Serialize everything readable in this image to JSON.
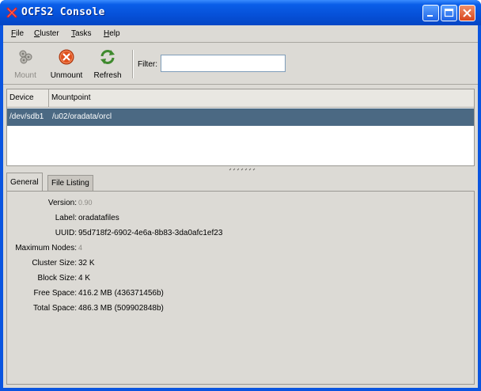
{
  "window": {
    "title": "OCFS2 Console"
  },
  "menu": {
    "file": {
      "mnemonic": "F",
      "rest": "ile"
    },
    "cluster": {
      "mnemonic": "C",
      "rest": "luster"
    },
    "tasks": {
      "mnemonic": "T",
      "rest": "asks"
    },
    "help": {
      "mnemonic": "H",
      "rest": "elp"
    }
  },
  "toolbar": {
    "mount_label": "Mount",
    "unmount_label": "Unmount",
    "refresh_label": "Refresh",
    "filter_label": "Filter:",
    "filter_value": ""
  },
  "device_list": {
    "columns": [
      "Device",
      "Mountpoint"
    ],
    "rows": [
      {
        "device": "/dev/sdb1",
        "mountpoint": "/u02/oradata/orcl"
      }
    ]
  },
  "tabs": [
    "General",
    "File Listing"
  ],
  "general": {
    "version": {
      "label": "Version:",
      "value": "0.90"
    },
    "label": {
      "label": "Label:",
      "value": "oradatafiles"
    },
    "uuid": {
      "label": "UUID:",
      "value": "95d718f2-6902-4e6a-8b83-3da0afc1ef23"
    },
    "max_nodes": {
      "label": "Maximum Nodes:",
      "value": "4"
    },
    "cluster_size": {
      "label": "Cluster Size:",
      "value": "32 K"
    },
    "block_size": {
      "label": "Block Size:",
      "value": "4 K"
    },
    "free_space": {
      "label": "Free Space:",
      "value": "416.2 MB (436371456b)"
    },
    "total_space": {
      "label": "Total Space:",
      "value": "486.3 MB (509902848b)"
    }
  },
  "colors": {
    "titlebar": "#0a5ee8",
    "selection": "#4b6983",
    "window_bg": "#dcdad5"
  }
}
